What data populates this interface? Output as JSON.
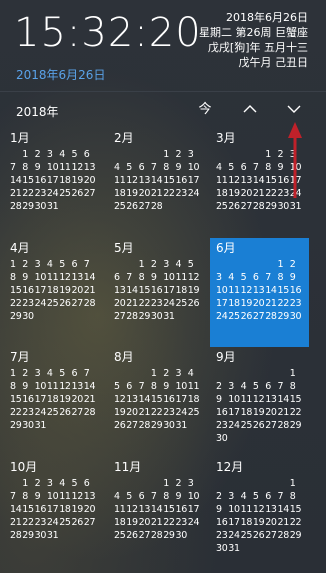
{
  "header": {
    "time": "15:32:20",
    "date_link": "2018年6月26日",
    "lunar_lines": [
      "2018年6月26日",
      "星期二 第26周 巨蟹座",
      "戊戌[狗]年 五月十三",
      "戊午月 己丑日"
    ]
  },
  "nav": {
    "year": "2018年",
    "today_label": "今",
    "up_icon": "chevron-up-icon",
    "down_icon": "chevron-down-icon"
  },
  "selected_month": "6月",
  "accent_color": "#1a7fd4",
  "months": [
    {
      "name": "1月",
      "rows": [
        [
          "1",
          "2",
          "3",
          "4",
          "5",
          "6"
        ],
        [
          "7",
          "8",
          "9",
          "10",
          "11",
          "12",
          "13"
        ],
        [
          "14",
          "15",
          "16",
          "17",
          "18",
          "19",
          "20"
        ],
        [
          "21",
          "22",
          "23",
          "24",
          "25",
          "26",
          "27"
        ],
        [
          "28",
          "29",
          "30",
          "31"
        ]
      ]
    },
    {
      "name": "2月",
      "rows": [
        [
          "1",
          "2",
          "3"
        ],
        [
          "4",
          "5",
          "6",
          "7",
          "8",
          "9",
          "10"
        ],
        [
          "11",
          "12",
          "13",
          "14",
          "15",
          "16",
          "17"
        ],
        [
          "18",
          "19",
          "20",
          "21",
          "22",
          "23",
          "24"
        ],
        [
          "25",
          "26",
          "27",
          "28"
        ]
      ]
    },
    {
      "name": "3月",
      "rows": [
        [
          "1",
          "2",
          "3"
        ],
        [
          "4",
          "5",
          "6",
          "7",
          "8",
          "9",
          "10"
        ],
        [
          "11",
          "12",
          "13",
          "14",
          "15",
          "16",
          "17"
        ],
        [
          "18",
          "19",
          "20",
          "21",
          "22",
          "23",
          "24"
        ],
        [
          "25",
          "26",
          "27",
          "28",
          "29",
          "30",
          "31"
        ]
      ]
    },
    {
      "name": "4月",
      "rows": [
        [
          "1",
          "2",
          "3",
          "4",
          "5",
          "6",
          "7"
        ],
        [
          "8",
          "9",
          "10",
          "11",
          "12",
          "13",
          "14"
        ],
        [
          "15",
          "16",
          "17",
          "18",
          "19",
          "20",
          "21"
        ],
        [
          "22",
          "23",
          "24",
          "25",
          "26",
          "27",
          "28"
        ],
        [
          "29",
          "30"
        ]
      ]
    },
    {
      "name": "5月",
      "rows": [
        [
          "1",
          "2",
          "3",
          "4",
          "5"
        ],
        [
          "6",
          "7",
          "8",
          "9",
          "10",
          "11",
          "12"
        ],
        [
          "13",
          "14",
          "15",
          "16",
          "17",
          "18",
          "19"
        ],
        [
          "20",
          "21",
          "22",
          "23",
          "24",
          "25",
          "26"
        ],
        [
          "27",
          "28",
          "29",
          "30",
          "31"
        ]
      ]
    },
    {
      "name": "6月",
      "rows": [
        [
          "1",
          "2"
        ],
        [
          "3",
          "4",
          "5",
          "6",
          "7",
          "8",
          "9"
        ],
        [
          "10",
          "11",
          "12",
          "13",
          "14",
          "15",
          "16"
        ],
        [
          "17",
          "18",
          "19",
          "20",
          "21",
          "22",
          "23"
        ],
        [
          "24",
          "25",
          "26",
          "27",
          "28",
          "29",
          "30"
        ]
      ]
    },
    {
      "name": "7月",
      "rows": [
        [
          "1",
          "2",
          "3",
          "4",
          "5",
          "6",
          "7"
        ],
        [
          "8",
          "9",
          "10",
          "11",
          "12",
          "13",
          "14"
        ],
        [
          "15",
          "16",
          "17",
          "18",
          "19",
          "20",
          "21"
        ],
        [
          "22",
          "23",
          "24",
          "25",
          "26",
          "27",
          "28"
        ],
        [
          "29",
          "30",
          "31"
        ]
      ]
    },
    {
      "name": "8月",
      "rows": [
        [
          "1",
          "2",
          "3",
          "4"
        ],
        [
          "5",
          "6",
          "7",
          "8",
          "9",
          "10",
          "11"
        ],
        [
          "12",
          "13",
          "14",
          "15",
          "16",
          "17",
          "18"
        ],
        [
          "19",
          "20",
          "21",
          "22",
          "23",
          "24",
          "25"
        ],
        [
          "26",
          "27",
          "28",
          "29",
          "30",
          "31"
        ]
      ]
    },
    {
      "name": "9月",
      "rows": [
        [
          "1"
        ],
        [
          "2",
          "3",
          "4",
          "5",
          "6",
          "7",
          "8"
        ],
        [
          "9",
          "10",
          "11",
          "12",
          "13",
          "14",
          "15"
        ],
        [
          "16",
          "17",
          "18",
          "19",
          "20",
          "21",
          "22"
        ],
        [
          "23",
          "24",
          "25",
          "26",
          "27",
          "28",
          "29"
        ],
        [
          "30"
        ]
      ]
    },
    {
      "name": "10月",
      "rows": [
        [
          "1",
          "2",
          "3",
          "4",
          "5",
          "6"
        ],
        [
          "7",
          "8",
          "9",
          "10",
          "11",
          "12",
          "13"
        ],
        [
          "14",
          "15",
          "16",
          "17",
          "18",
          "19",
          "20"
        ],
        [
          "21",
          "22",
          "23",
          "24",
          "25",
          "26",
          "27"
        ],
        [
          "28",
          "29",
          "30",
          "31"
        ]
      ]
    },
    {
      "name": "11月",
      "rows": [
        [
          "1",
          "2",
          "3"
        ],
        [
          "4",
          "5",
          "6",
          "7",
          "8",
          "9",
          "10"
        ],
        [
          "11",
          "12",
          "13",
          "14",
          "15",
          "16",
          "17"
        ],
        [
          "18",
          "19",
          "20",
          "21",
          "22",
          "23",
          "24"
        ],
        [
          "25",
          "26",
          "27",
          "28",
          "29",
          "30"
        ]
      ]
    },
    {
      "name": "12月",
      "rows": [
        [
          "1"
        ],
        [
          "2",
          "3",
          "4",
          "5",
          "6",
          "7",
          "8"
        ],
        [
          "9",
          "10",
          "11",
          "12",
          "13",
          "14",
          "15"
        ],
        [
          "16",
          "17",
          "18",
          "19",
          "20",
          "21",
          "22"
        ],
        [
          "23",
          "24",
          "25",
          "26",
          "27",
          "28",
          "29"
        ],
        [
          "30",
          "31"
        ]
      ]
    }
  ]
}
